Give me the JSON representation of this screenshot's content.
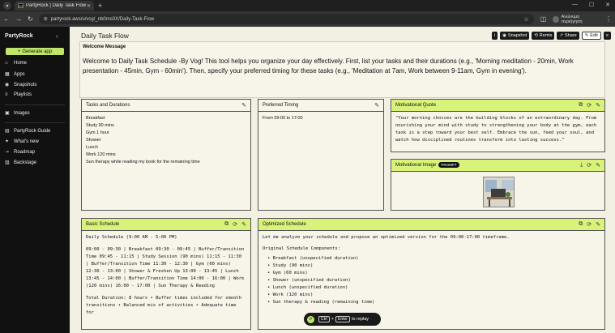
{
  "browser": {
    "tab_title": "PartyRock | Daily Task Flow",
    "favicon_text": "PR",
    "url": "partyrock.aws/u/vcg/_nb0ms0X/Daily-Task-Flow",
    "profile_name": "Ανώνυμη περιήγηση"
  },
  "sidebar": {
    "brand": "PartyRock",
    "generate_label": "Generate app",
    "items": [
      {
        "label": "Home",
        "icon": "home-icon"
      },
      {
        "label": "Apps",
        "icon": "apps-icon"
      },
      {
        "label": "Snapshots",
        "icon": "camera-icon"
      },
      {
        "label": "Playlists",
        "icon": "playlist-icon"
      },
      {
        "label": "Images",
        "icon": "image-icon"
      },
      {
        "label": "PartyRock Guide",
        "icon": "guide-icon"
      },
      {
        "label": "What's new",
        "icon": "sparkle-icon"
      },
      {
        "label": "Roadmap",
        "icon": "roadmap-icon"
      },
      {
        "label": "Backstage",
        "icon": "backstage-icon"
      }
    ]
  },
  "page": {
    "title": "Daily Task Flow",
    "toolbar": {
      "info": "i",
      "snapshot": "Snapshot",
      "remix": "Remix",
      "share": "Share",
      "edit": "Edit"
    }
  },
  "welcome": {
    "label": "Welcome Message",
    "text": "Welcome to Daily Task Schedule -By Vog! This tool helps you organize your day effectively. First, list your tasks and their durations (e.g., 'Morning meditation - 20min, Work presentation - 45min, Gym - 60min'). Then, specify your preferred timing for these tasks (e.g., 'Meditation at 7am, Work between 9-11am, Gym in evening')."
  },
  "tasks": {
    "title": "Tasks and Durations",
    "lines": [
      "Breakfast",
      "Study 90 mins",
      "Gym 1 hour",
      "Shower",
      "Lunch",
      "Work 120 mins",
      "Sun therapy while reading my book for the remaining time"
    ]
  },
  "timing": {
    "title": "Preferred Timing",
    "value": "From 09:00 to 17:00"
  },
  "quote": {
    "title": "Motivational Quote",
    "text": "\"Your morning choices are the building blocks of an extraordinary day. From nourishing your mind with study to strengthening your body at the gym, each task is a step toward your best self. Embrace the sun, feed your soul, and watch how disciplined routines transform into lasting success.\""
  },
  "image_card": {
    "title": "Motivational Image",
    "badge": "PROMPT"
  },
  "basic": {
    "title": "Basic Schedule",
    "heading": "Daily Schedule (9:00 AM - 5:00 PM)",
    "para1": "09:00 - 09:30 | Breakfast 09:30 - 09:45 | Buffer/Transition Time 09:45 - 11:15 | Study Session (90 mins) 11:15 - 11:30 | Buffer/Transition Time 11:30 - 12:30 | Gym (60 mins) 12:30 - 13:00 | Shower & Freshen Up 13:00 - 13:45 | Lunch 13:45 - 14:00 | Buffer/Transition Time 14:00 - 16:00 | Work (120 mins) 16:00 - 17:00 | Sun Therapy & Reading",
    "para2": "Total Duration: 8 hours • Buffer times included for smooth transitions • Balanced mix of activities • Adequate time for"
  },
  "optimized": {
    "title": "Optimized Schedule",
    "intro": "Let me analyze your schedule and propose an optimized version for the 09:00-17:00 timeframe.",
    "subhead": "Original Schedule Components:",
    "items": [
      "Breakfast (unspecified duration)",
      "Study (90 mins)",
      "Gym (60 mins)",
      "Shower (unspecified duration)",
      "Lunch (unspecified duration)",
      "Work (120 mins)",
      "Sun therapy & reading (remaining time)"
    ]
  },
  "replay": {
    "key1": "Ctrl",
    "key2": "Enter",
    "label": "to replay"
  }
}
